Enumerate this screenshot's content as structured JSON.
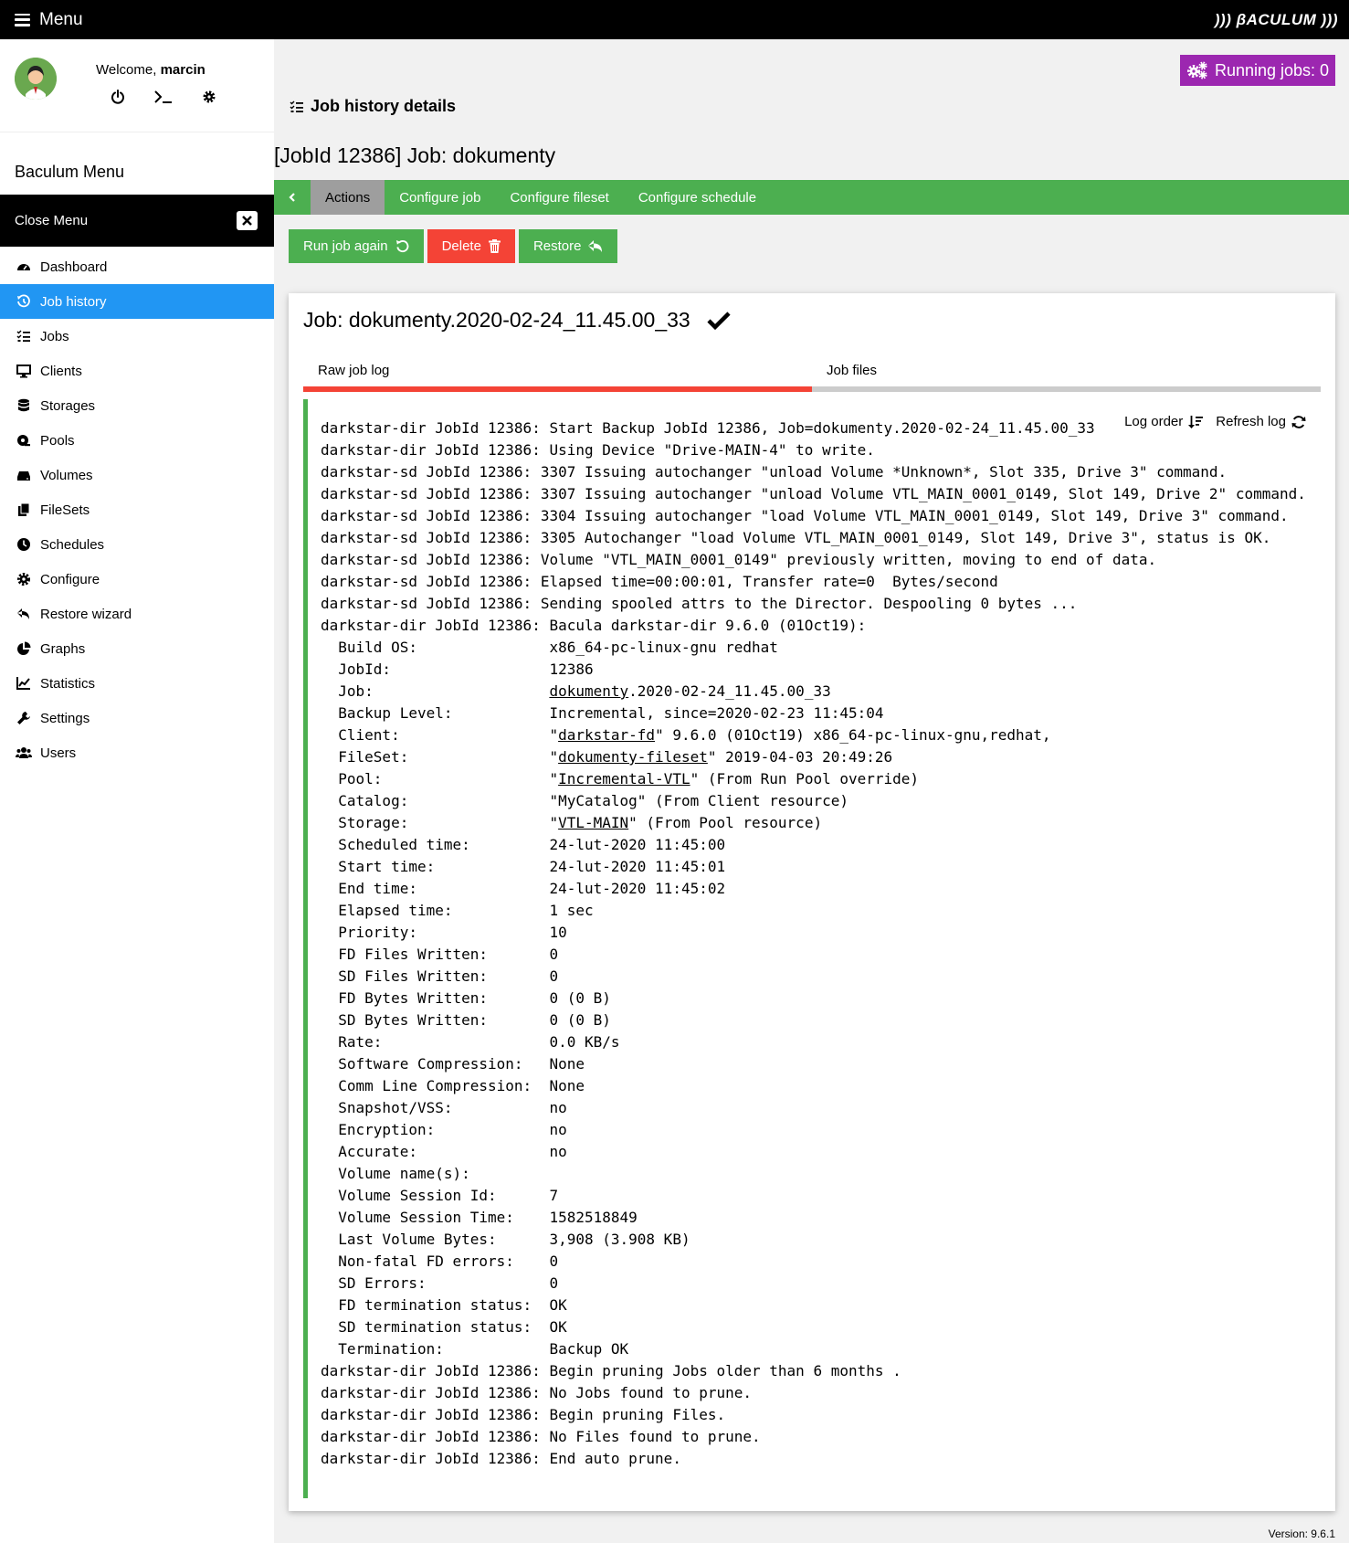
{
  "topbar": {
    "menu_label": "Menu",
    "logo": "))) βACULUM )))"
  },
  "user": {
    "welcome_prefix": "Welcome, ",
    "username": "marcin"
  },
  "sidebar": {
    "title": "Baculum Menu",
    "close_label": "Close Menu",
    "items": [
      {
        "label": "Dashboard",
        "icon": "dashboard-icon"
      },
      {
        "label": "Job history",
        "icon": "history-icon"
      },
      {
        "label": "Jobs",
        "icon": "tasks-icon"
      },
      {
        "label": "Clients",
        "icon": "desktop-icon"
      },
      {
        "label": "Storages",
        "icon": "database-icon"
      },
      {
        "label": "Pools",
        "icon": "pool-icon"
      },
      {
        "label": "Volumes",
        "icon": "hdd-icon"
      },
      {
        "label": "FileSets",
        "icon": "copy-icon"
      },
      {
        "label": "Schedules",
        "icon": "clock-icon"
      },
      {
        "label": "Configure",
        "icon": "cog-icon"
      },
      {
        "label": "Restore wizard",
        "icon": "reply-icon"
      },
      {
        "label": "Graphs",
        "icon": "pie-chart-icon"
      },
      {
        "label": "Statistics",
        "icon": "line-chart-icon"
      },
      {
        "label": "Settings",
        "icon": "wrench-icon"
      },
      {
        "label": "Users",
        "icon": "users-icon"
      }
    ]
  },
  "main": {
    "running_jobs": "Running jobs: 0",
    "heading": "Job history details",
    "job_title": "[JobId 12386] Job: dokumenty",
    "tabs": [
      "Actions",
      "Configure job",
      "Configure fileset",
      "Configure schedule"
    ],
    "buttons": {
      "run_again": "Run job again",
      "delete": "Delete",
      "restore": "Restore"
    },
    "card_title": "Job: dokumenty.2020-02-24_11.45.00_33",
    "subtabs": [
      "Raw job log",
      "Job files"
    ],
    "log_order": "Log order",
    "refresh_log": "Refresh log",
    "log_lines": {
      "l1": "darkstar-dir JobId 12386: Start Backup JobId 12386, Job=dokumenty.2020-02-24_11.45.00_33",
      "l2": "darkstar-dir JobId 12386: Using Device \"Drive-MAIN-4\" to write.",
      "l3": "darkstar-sd JobId 12386: 3307 Issuing autochanger \"unload Volume *Unknown*, Slot 335, Drive 3\" command.",
      "l4": "darkstar-sd JobId 12386: 3307 Issuing autochanger \"unload Volume VTL_MAIN_0001_0149, Slot 149, Drive 2\" command.",
      "l5": "darkstar-sd JobId 12386: 3304 Issuing autochanger \"load Volume VTL_MAIN_0001_0149, Slot 149, Drive 3\" command.",
      "l6": "darkstar-sd JobId 12386: 3305 Autochanger \"load Volume VTL_MAIN_0001_0149, Slot 149, Drive 3\", status is OK.",
      "l7": "darkstar-sd JobId 12386: Volume \"VTL_MAIN_0001_0149\" previously written, moving to end of data.",
      "l8": "darkstar-sd JobId 12386: Elapsed time=00:00:01, Transfer rate=0  Bytes/second",
      "l9": "darkstar-sd JobId 12386: Sending spooled attrs to the Director. Despooling 0 bytes ...",
      "l10": "darkstar-dir JobId 12386: Bacula darkstar-dir 9.6.0 (01Oct19):",
      "l11": "  Build OS:               x86_64-pc-linux-gnu redhat",
      "l12": "  JobId:                  12386",
      "l13a": "  Job:                    ",
      "l13b": "dokumenty",
      "l13c": ".2020-02-24_11.45.00_33",
      "l14": "  Backup Level:           Incremental, since=2020-02-23 11:45:04",
      "l15a": "  Client:                 \"",
      "l15b": "darkstar-fd",
      "l15c": "\" 9.6.0 (01Oct19) x86_64-pc-linux-gnu,redhat,",
      "l16a": "  FileSet:                \"",
      "l16b": "dokumenty-fileset",
      "l16c": "\" 2019-04-03 20:49:26",
      "l17a": "  Pool:                   \"",
      "l17b": "Incremental-VTL",
      "l17c": "\" (From Run Pool override)",
      "l18": "  Catalog:                \"MyCatalog\" (From Client resource)",
      "l19a": "  Storage:                \"",
      "l19b": "VTL-MAIN",
      "l19c": "\" (From Pool resource)",
      "l20": "  Scheduled time:         24-lut-2020 11:45:00",
      "l21": "  Start time:             24-lut-2020 11:45:01",
      "l22": "  End time:               24-lut-2020 11:45:02",
      "l23": "  Elapsed time:           1 sec",
      "l24": "  Priority:               10",
      "l25": "  FD Files Written:       0",
      "l26": "  SD Files Written:       0",
      "l27": "  FD Bytes Written:       0 (0 B)",
      "l28": "  SD Bytes Written:       0 (0 B)",
      "l29": "  Rate:                   0.0 KB/s",
      "l30": "  Software Compression:   None",
      "l31": "  Comm Line Compression:  None",
      "l32": "  Snapshot/VSS:           no",
      "l33": "  Encryption:             no",
      "l34": "  Accurate:               no",
      "l35": "  Volume name(s):",
      "l36": "  Volume Session Id:      7",
      "l37": "  Volume Session Time:    1582518849",
      "l38": "  Last Volume Bytes:      3,908 (3.908 KB)",
      "l39": "  Non-fatal FD errors:    0",
      "l40": "  SD Errors:              0",
      "l41": "  FD termination status:  OK",
      "l42": "  SD termination status:  OK",
      "l43": "  Termination:            Backup OK",
      "l44": "darkstar-dir JobId 12386: Begin pruning Jobs older than 6 months .",
      "l45": "darkstar-dir JobId 12386: No Jobs found to prune.",
      "l46": "darkstar-dir JobId 12386: Begin pruning Files.",
      "l47": "darkstar-dir JobId 12386: No Files found to prune.",
      "l48": "darkstar-dir JobId 12386: End auto prune."
    }
  },
  "footer": {
    "version": "Version: 9.6.1"
  },
  "colors": {
    "green": "#4caf50",
    "red": "#f44336",
    "blue": "#2196f3",
    "purple": "#9c27b0"
  }
}
